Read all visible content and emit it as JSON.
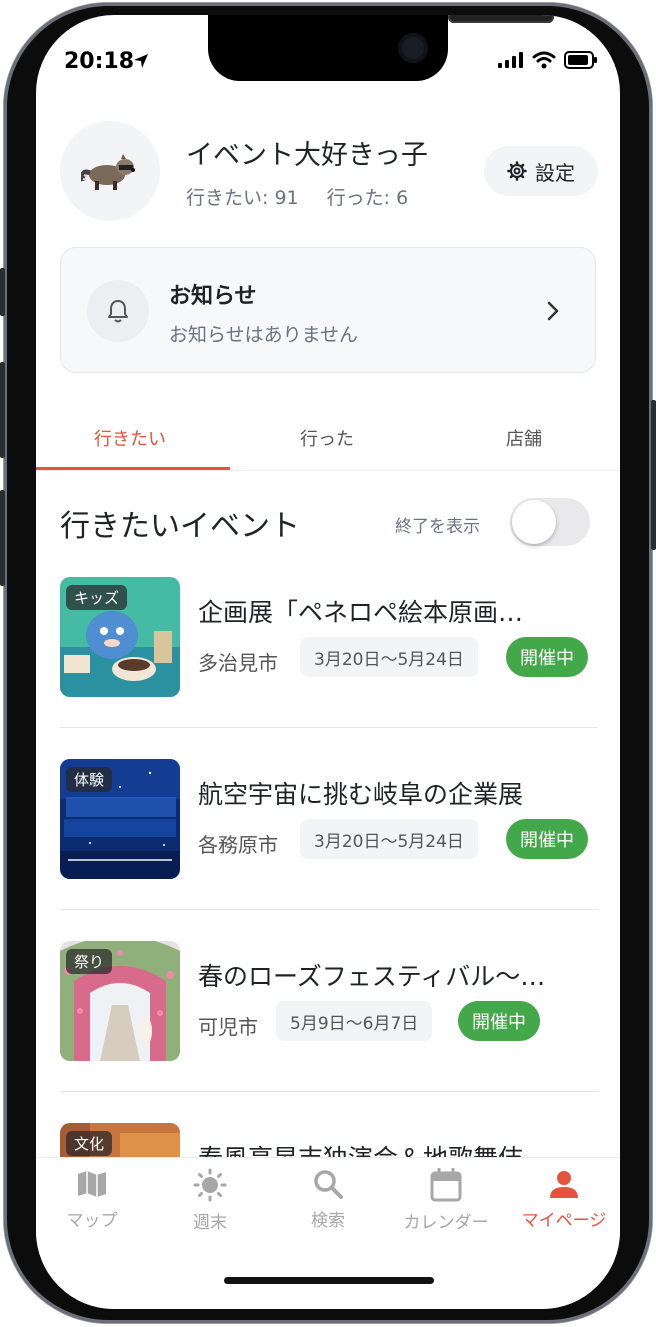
{
  "status": {
    "time": "20:18"
  },
  "profile": {
    "name": "イベント大好きっ子",
    "want_label": "行きたい: 91",
    "went_label": "行った: 6",
    "settings_label": "設定"
  },
  "notice": {
    "title": "お知らせ",
    "subtitle": "お知らせはありません"
  },
  "tabs": [
    {
      "label": "行きたい",
      "active": true
    },
    {
      "label": "行った",
      "active": false
    },
    {
      "label": "店舗",
      "active": false
    }
  ],
  "list": {
    "title": "行きたいイベント",
    "toggle_label": "終了を表示",
    "toggle_on": false
  },
  "events": [
    {
      "tag": "キッズ",
      "title": "企画展「ペネロペ絵本原画…",
      "city": "多治見市",
      "dates": "3月20日〜5月24日",
      "status": "開催中",
      "thumb_colors": [
        "#3fb8a4",
        "#7ed3b3"
      ]
    },
    {
      "tag": "体験",
      "title": "航空宇宙に挑む岐阜の企業展",
      "city": "各務原市",
      "dates": "3月20日〜5月24日",
      "status": "開催中",
      "thumb_colors": [
        "#0b2a6e",
        "#1c5cc4"
      ]
    },
    {
      "tag": "祭り",
      "title": "春のローズフェスティバル〜…",
      "city": "可児市",
      "dates": "5月9日〜6月7日",
      "status": "開催中",
      "thumb_colors": [
        "#c95475",
        "#7fa36a"
      ]
    },
    {
      "tag": "文化",
      "title": "春風亭昇吉独演会＆地歌舞伎",
      "city": "",
      "dates": "",
      "status": "",
      "thumb_colors": [
        "#b8623a",
        "#e59a4a"
      ]
    }
  ],
  "nav": [
    {
      "label": "マップ",
      "icon": "map-icon",
      "active": false
    },
    {
      "label": "週末",
      "icon": "sun-icon",
      "active": false
    },
    {
      "label": "検索",
      "icon": "search-icon",
      "active": false
    },
    {
      "label": "カレンダー",
      "icon": "calendar-icon",
      "active": false
    },
    {
      "label": "マイページ",
      "icon": "person-icon",
      "active": true
    }
  ],
  "colors": {
    "accent": "#e5533d",
    "status_green": "#43a84a"
  }
}
